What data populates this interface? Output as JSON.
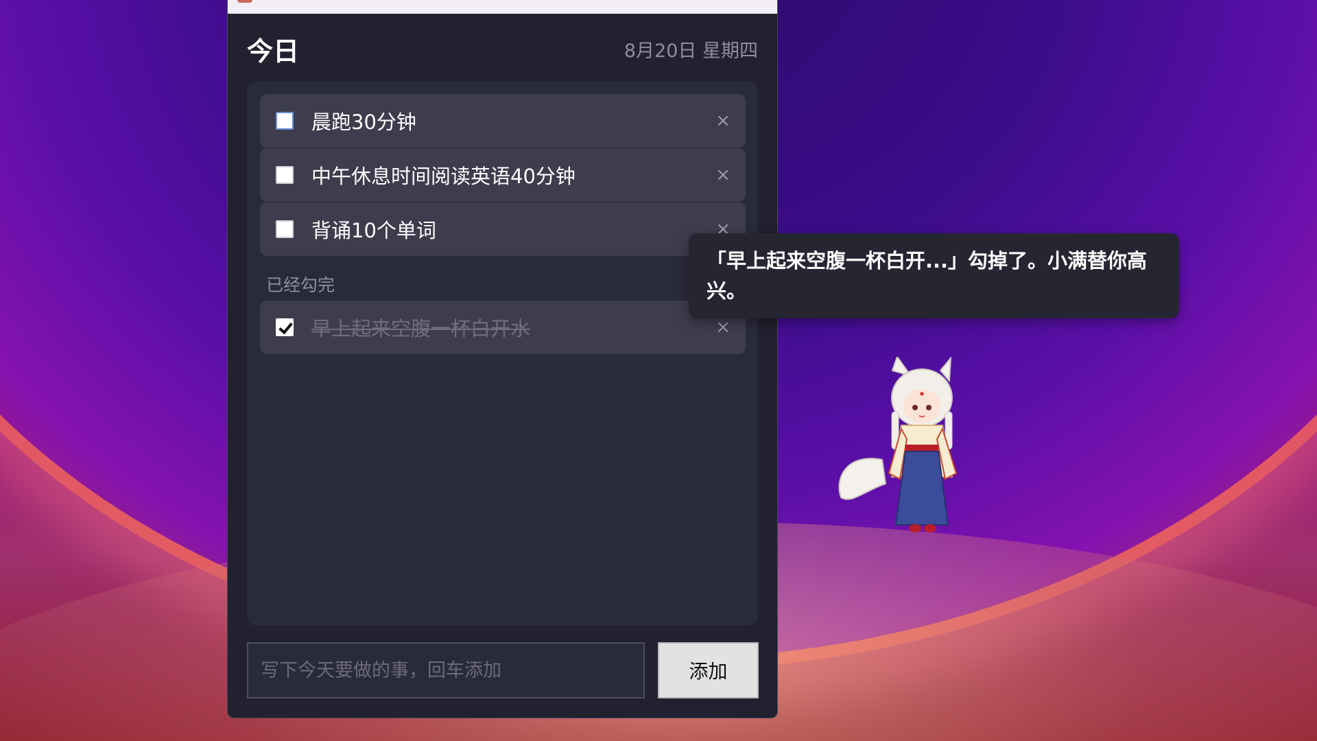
{
  "window": {
    "header_title": "今日",
    "header_date": "8月20日 星期四"
  },
  "todos": [
    {
      "label": "晨跑30分钟",
      "checked": false,
      "delete_icon": "×"
    },
    {
      "label": "中午休息时间阅读英语40分钟",
      "checked": false,
      "delete_icon": "×"
    },
    {
      "label": "背诵10个单词",
      "checked": false,
      "delete_icon": "×"
    }
  ],
  "completed_section": {
    "label": "已经勾完",
    "items": [
      {
        "label": "早上起来空腹一杯白开水",
        "checked": true,
        "delete_icon": "×"
      }
    ]
  },
  "composer": {
    "placeholder": "写下今天要做的事，回车添加",
    "value": "",
    "button_label": "添加"
  },
  "mascot_bubble": {
    "text": "「早上起来空腹一杯白开...」勾掉了。小满替你高兴。"
  },
  "icons": {
    "delete": "close-icon",
    "checkbox": "checkbox-icon"
  }
}
